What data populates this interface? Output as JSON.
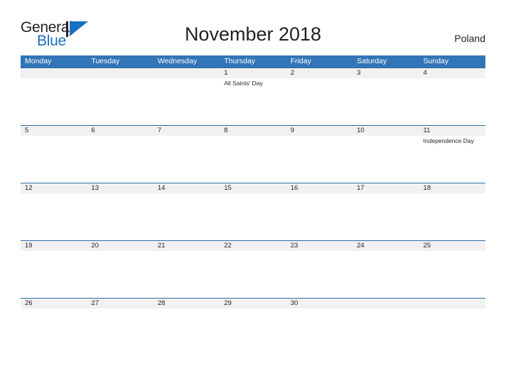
{
  "brand": {
    "name_part1": "General",
    "name_part2": "Blue",
    "mark": "triangle-logo-icon",
    "color_dark": "#231f20",
    "color_blue": "#1b6ec2"
  },
  "header": {
    "title": "November 2018",
    "country": "Poland"
  },
  "theme": {
    "header_blue": "#3275b7",
    "row_divider_blue": "#2e6da8",
    "date_band_gray": "#f1f1f1",
    "text_color": "#231f20"
  },
  "calendar": {
    "month": "November",
    "year": "2018",
    "weekday_headers": [
      "Monday",
      "Tuesday",
      "Wednesday",
      "Thursday",
      "Friday",
      "Saturday",
      "Sunday"
    ],
    "weeks": [
      {
        "days": [
          {
            "number": "",
            "event": ""
          },
          {
            "number": "",
            "event": ""
          },
          {
            "number": "",
            "event": ""
          },
          {
            "number": "1",
            "event": "All Saints’ Day"
          },
          {
            "number": "2",
            "event": ""
          },
          {
            "number": "3",
            "event": ""
          },
          {
            "number": "4",
            "event": ""
          }
        ]
      },
      {
        "days": [
          {
            "number": "5",
            "event": ""
          },
          {
            "number": "6",
            "event": ""
          },
          {
            "number": "7",
            "event": ""
          },
          {
            "number": "8",
            "event": ""
          },
          {
            "number": "9",
            "event": ""
          },
          {
            "number": "10",
            "event": ""
          },
          {
            "number": "11",
            "event": "Independence Day"
          }
        ]
      },
      {
        "days": [
          {
            "number": "12",
            "event": ""
          },
          {
            "number": "13",
            "event": ""
          },
          {
            "number": "14",
            "event": ""
          },
          {
            "number": "15",
            "event": ""
          },
          {
            "number": "16",
            "event": ""
          },
          {
            "number": "17",
            "event": ""
          },
          {
            "number": "18",
            "event": ""
          }
        ]
      },
      {
        "days": [
          {
            "number": "19",
            "event": ""
          },
          {
            "number": "20",
            "event": ""
          },
          {
            "number": "21",
            "event": ""
          },
          {
            "number": "22",
            "event": ""
          },
          {
            "number": "23",
            "event": ""
          },
          {
            "number": "24",
            "event": ""
          },
          {
            "number": "25",
            "event": ""
          }
        ]
      },
      {
        "days": [
          {
            "number": "26",
            "event": ""
          },
          {
            "number": "27",
            "event": ""
          },
          {
            "number": "28",
            "event": ""
          },
          {
            "number": "29",
            "event": ""
          },
          {
            "number": "30",
            "event": ""
          },
          {
            "number": "",
            "event": ""
          },
          {
            "number": "",
            "event": ""
          }
        ]
      }
    ]
  }
}
